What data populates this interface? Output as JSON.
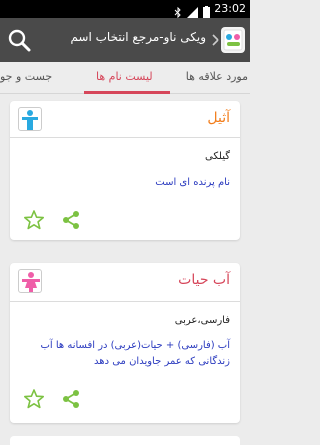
{
  "status_bar": {
    "time": "23:02"
  },
  "app_bar": {
    "title": "ویکی ناو-مرجع انتخاب اسم"
  },
  "tabs": [
    {
      "label": "جست و جو"
    },
    {
      "label": "لیست نام ها",
      "active": true
    },
    {
      "label": "مورد علاقه ها"
    }
  ],
  "colors": {
    "accent": "#d6465a",
    "male_name": "#f27d1b",
    "female_name": "#d6465a",
    "meaning": "#2b3bbf",
    "icon_green": "#7cc242",
    "male_icon": "#29a9e0",
    "female_icon": "#ef5ea8"
  },
  "names": [
    {
      "name": "آثیل",
      "gender_icon": "male-icon",
      "origin": "گیلکی",
      "meaning": "نام پرنده ای است"
    },
    {
      "name": "آب حیات",
      "gender_icon": "female-icon",
      "origin": "فارسی،عربی",
      "meaning": "آب (فارسی) + حیات(عربی) در افسانه ها آب زندگانی که عمر جاویدان می دهد"
    }
  ]
}
